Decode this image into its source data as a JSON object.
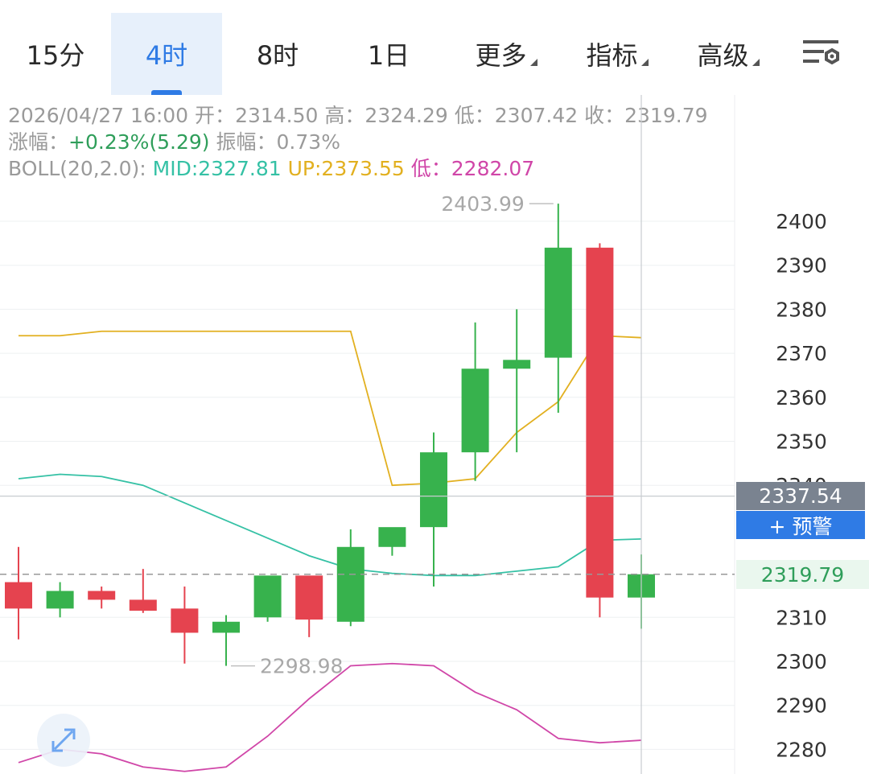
{
  "tabs": [
    {
      "label": "15分",
      "active": false
    },
    {
      "label": "4时",
      "active": true
    },
    {
      "label": "8时",
      "active": false
    },
    {
      "label": "1日",
      "active": false
    },
    {
      "label": "更多",
      "active": false,
      "dropdown": true
    },
    {
      "label": "指标",
      "active": false,
      "dropdown": true
    },
    {
      "label": "高级",
      "active": false,
      "dropdown": true
    }
  ],
  "info": {
    "datetime": "2026/04/27 16:00",
    "open_label": "开：",
    "open": "2314.50",
    "high_label": "高：",
    "high": "2324.29",
    "low_label": "低：",
    "low": "2307.42",
    "close_label": "收：",
    "close": "2319.79",
    "change_label": "涨幅：",
    "change": "+0.23%(5.29)",
    "amp_label": "振幅：",
    "amp": "0.73%",
    "boll_label": "BOLL(20,2.0):",
    "mid_label": "MID:",
    "mid": "2327.81",
    "up_label": "UP:",
    "up": "2373.55",
    "lowb_label": "LOW:",
    "lowb": "2282.07"
  },
  "price_tag": "2337.54",
  "alert_label": "+ 预警",
  "close_tag": "2319.79",
  "colors": {
    "up": "#37b24d",
    "down": "#e5434f",
    "mid": "#35c1a5",
    "upper": "#e2b020",
    "lower": "#d046a8",
    "accent": "#2f7be5"
  },
  "chart_data": {
    "type": "candlestick",
    "y_ticks": [
      2400,
      2390,
      2380,
      2370,
      2360,
      2350,
      2340,
      2310,
      2300,
      2290,
      2280
    ],
    "ylim": [
      2275,
      2415
    ],
    "candles": [
      {
        "o": 2318,
        "h": 2326,
        "l": 2305,
        "c": 2312
      },
      {
        "o": 2312,
        "h": 2318,
        "l": 2310,
        "c": 2316
      },
      {
        "o": 2316,
        "h": 2317,
        "l": 2312,
        "c": 2314
      },
      {
        "o": 2314,
        "h": 2321,
        "l": 2311,
        "c": 2311.5
      },
      {
        "o": 2312,
        "h": 2317,
        "l": 2299.5,
        "c": 2306.5
      },
      {
        "o": 2306.5,
        "h": 2310.5,
        "l": 2298.98,
        "c": 2309
      },
      {
        "o": 2310,
        "h": 2318,
        "l": 2309,
        "c": 2319.5
      },
      {
        "o": 2319.5,
        "h": 2318,
        "l": 2305.5,
        "c": 2309.5
      },
      {
        "o": 2309,
        "h": 2330,
        "l": 2308,
        "c": 2326
      },
      {
        "o": 2326,
        "h": 2328.5,
        "l": 2324,
        "c": 2330.5
      },
      {
        "o": 2330.5,
        "h": 2352,
        "l": 2317,
        "c": 2347.5
      },
      {
        "o": 2347.5,
        "h": 2377,
        "l": 2341,
        "c": 2366.5
      },
      {
        "o": 2366.5,
        "h": 2380,
        "l": 2347.5,
        "c": 2368.5
      },
      {
        "o": 2369,
        "h": 2403.99,
        "l": 2356.5,
        "c": 2394
      },
      {
        "o": 2394,
        "h": 2395,
        "l": 2310,
        "c": 2314.5
      },
      {
        "o": 2314.5,
        "h": 2324.29,
        "l": 2307.42,
        "c": 2319.79
      }
    ],
    "boll_upper": [
      2374,
      2374,
      2375,
      2375,
      2375,
      2375,
      2375,
      2375,
      2375,
      2340,
      2340.5,
      2341.5,
      2352,
      2359,
      2374,
      2373.55
    ],
    "boll_mid": [
      2341.5,
      2342.5,
      2342,
      2340,
      2336,
      2332,
      2328,
      2324,
      2321,
      2320,
      2319.5,
      2319.5,
      2320.5,
      2321.5,
      2327.5,
      2327.81
    ],
    "boll_lower": [
      2277,
      2280,
      2279,
      2276,
      2275,
      2276,
      2283,
      2291.5,
      2299,
      2299.5,
      2299,
      2293,
      2289,
      2282.5,
      2281.5,
      2282.07
    ],
    "max_label": "2403.99",
    "min_label": "2298.98",
    "last_close": 2319.79,
    "crosshair_price": 2337.54
  }
}
